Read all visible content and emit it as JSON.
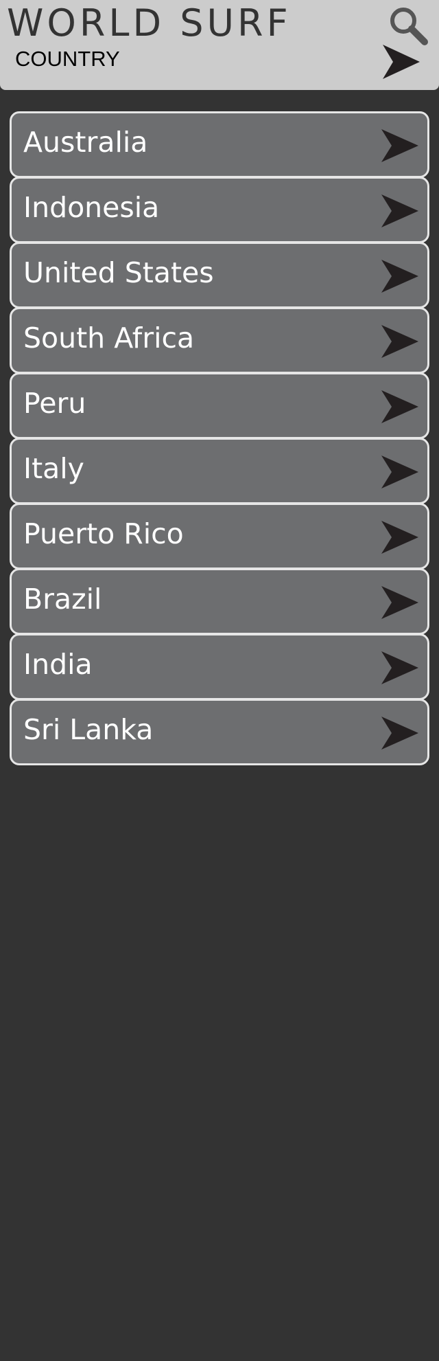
{
  "header": {
    "title": "WORLD SURF",
    "section_label": "COUNTRY",
    "search_icon": "search-icon",
    "forward_icon": "arrow-right-icon"
  },
  "countries": [
    {
      "label": "Australia"
    },
    {
      "label": "Indonesia"
    },
    {
      "label": "United States"
    },
    {
      "label": "South Africa"
    },
    {
      "label": "Peru"
    },
    {
      "label": "Italy"
    },
    {
      "label": "Puerto Rico"
    },
    {
      "label": "Brazil"
    },
    {
      "label": "India"
    },
    {
      "label": "Sri Lanka"
    }
  ],
  "colors": {
    "background": "#333333",
    "header": "#cccccc",
    "row": "#6d6e70",
    "row_border": "#e6e6e6",
    "arrow": "#231f20"
  }
}
